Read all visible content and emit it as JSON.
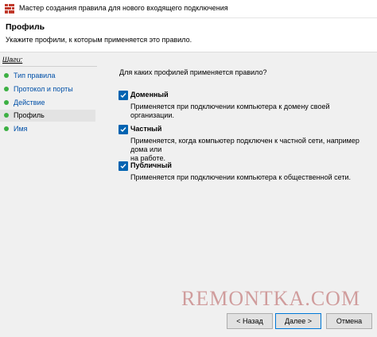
{
  "window": {
    "title": "Мастер создания правила для нового входящего подключения"
  },
  "header": {
    "title": "Профиль",
    "subtitle": "Укажите профили, к которым применяется это правило."
  },
  "sidebar": {
    "steps_label": "Шаги:",
    "items": [
      {
        "label": "Тип правила"
      },
      {
        "label": "Протокол и порты"
      },
      {
        "label": "Действие"
      },
      {
        "label": "Профиль"
      },
      {
        "label": "Имя"
      }
    ]
  },
  "main": {
    "question": "Для каких профилей применяется правило?",
    "options": [
      {
        "label": "Доменный",
        "checked": true,
        "desc1": "Применяется при подключении компьютера к домену своей организации.",
        "desc2": ""
      },
      {
        "label": "Частный",
        "checked": true,
        "desc1": "Применяется, когда компьютер подключен к частной сети, например дома или",
        "desc2": "на работе."
      },
      {
        "label": "Публичный",
        "checked": true,
        "desc1": "Применяется при подключении компьютера к общественной сети.",
        "desc2": ""
      }
    ]
  },
  "buttons": {
    "back": "< Назад",
    "next": "Далее >",
    "cancel": "Отмена"
  },
  "watermark": "REMONTKA.COM",
  "colors": {
    "accent": "#0063b1",
    "step_dot": "#3cb043",
    "link": "#0050a8"
  }
}
